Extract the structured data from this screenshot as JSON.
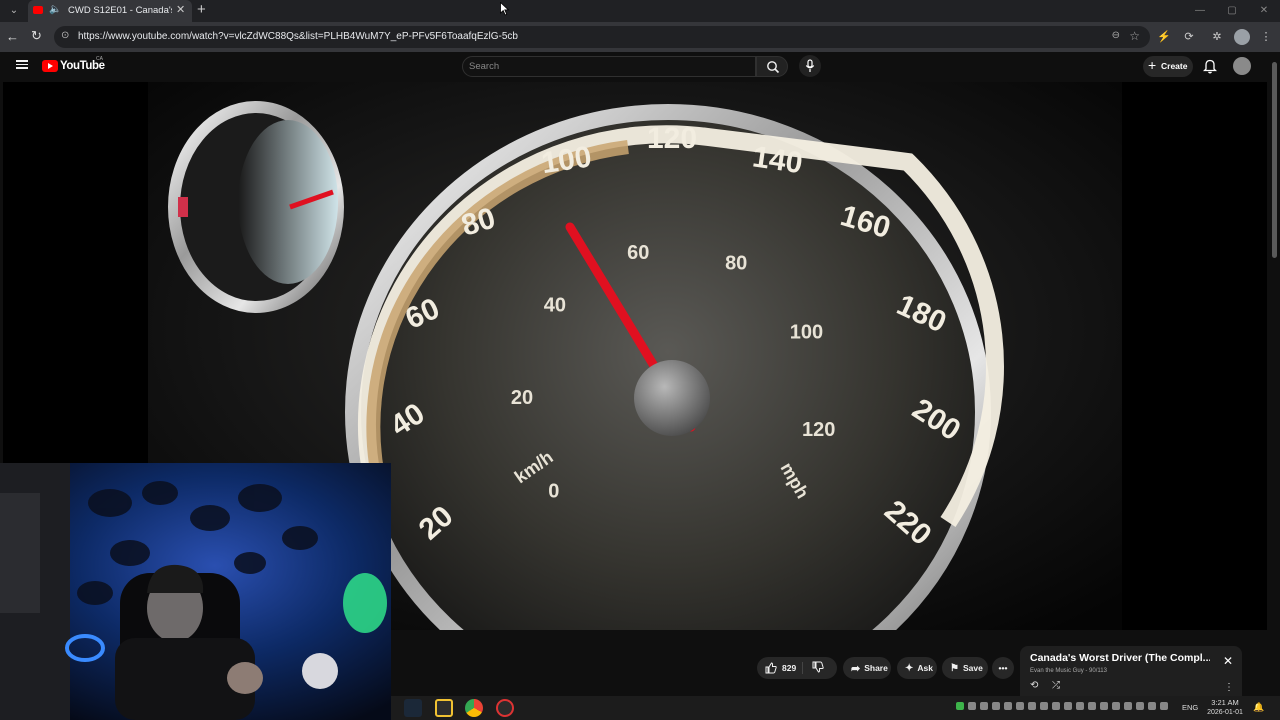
{
  "browser": {
    "tab": {
      "title": "CWD S12E01 - Canada's Worst Driver",
      "close_glyph": "✕",
      "speaker_glyph": "🔈"
    },
    "new_tab_glyph": "+",
    "url": "https://www.youtube.com/watch?v=vlcZdWC88Qs&list=PLHB4WuM7Y_eP-PFv5F6ToaafqEzlG-5cb"
  },
  "youtube": {
    "logo_text": "YouTube",
    "country_code": "CA",
    "search_placeholder": "Search",
    "create_label": "Create"
  },
  "video": {
    "speedometer": {
      "kmh_labels": [
        "20",
        "40",
        "60",
        "80",
        "100",
        "120",
        "140",
        "160",
        "180",
        "200",
        "220"
      ],
      "mph_labels": [
        "0",
        "20",
        "40",
        "60",
        "80",
        "100",
        "120"
      ],
      "unit_kmh": "km/h",
      "unit_mph": "mph"
    }
  },
  "actions": {
    "like_count": "829",
    "share_label": "Share",
    "ask_label": "Ask",
    "save_label": "Save"
  },
  "playlist_queue": {
    "title": "Canada's Worst Driver (The Compl...",
    "subtitle": "Evan the Music Guy - 90/113"
  },
  "taskbar": {
    "language": "ENG",
    "time": "3:21 AM",
    "date": "2026-01-01"
  },
  "colors": {
    "youtube_red": "#ff0000",
    "needle_red": "#e01020",
    "webcam_blue": "#1f5fd6",
    "webcam_green": "#2fe08a"
  }
}
